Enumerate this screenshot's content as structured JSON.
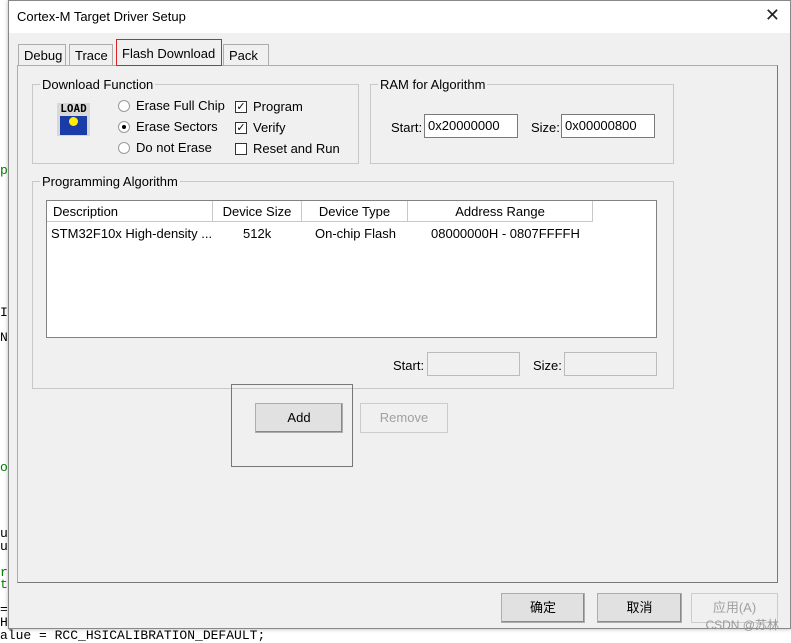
{
  "background_code": {
    "l1": "p",
    "l2": "I",
    "l3": "N",
    "l4": "o",
    "l5": "u",
    "l6": "u",
    "l7": "r",
    "l8": "t",
    "l9": "=",
    "l10": "H",
    "l11": "alue = RCC_HSICALIBRATION_DEFAULT;"
  },
  "dialog": {
    "title": "Cortex-M Target Driver Setup",
    "close": "✕"
  },
  "tabs": [
    {
      "label": "Debug"
    },
    {
      "label": "Trace"
    },
    {
      "label": "Flash Download",
      "active": true
    },
    {
      "label": "Pack"
    }
  ],
  "download_function": {
    "legend": "Download Function",
    "icon": "load-icon",
    "icon_text": "LOAD",
    "erase_options": [
      {
        "label": "Erase Full Chip",
        "selected": false
      },
      {
        "label": "Erase Sectors",
        "selected": true
      },
      {
        "label": "Do not Erase",
        "selected": false
      }
    ],
    "checks": [
      {
        "label": "Program",
        "checked": true
      },
      {
        "label": "Verify",
        "checked": true
      },
      {
        "label": "Reset and Run",
        "checked": false
      }
    ]
  },
  "ram": {
    "legend": "RAM for Algorithm",
    "start_label": "Start:",
    "start_value": "0x20000000",
    "size_label": "Size:",
    "size_value": "0x00000800"
  },
  "algorithm": {
    "legend": "Programming Algorithm",
    "columns": [
      "Description",
      "Device Size",
      "Device Type",
      "Address Range"
    ],
    "rows": [
      {
        "description": "STM32F10x High-density ...",
        "size": "512k",
        "type": "On-chip Flash",
        "range": "08000000H - 0807FFFFH"
      }
    ],
    "start_label": "Start:",
    "start_value": "",
    "size_label": "Size:",
    "size_value": ""
  },
  "buttons": {
    "add": "Add",
    "remove": "Remove",
    "ok": "确定",
    "cancel": "取消",
    "apply": "应用(A)"
  },
  "watermark": "CSDN @苏林"
}
